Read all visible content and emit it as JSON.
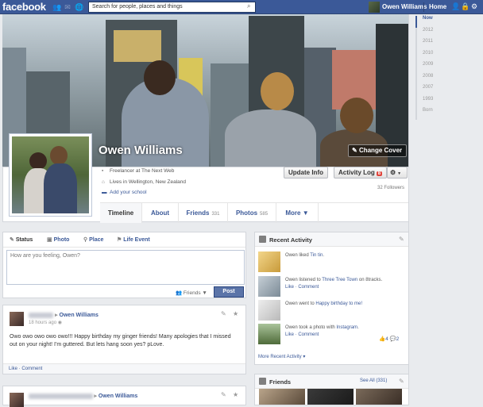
{
  "topbar": {
    "logo": "facebook",
    "search_placeholder": "Search for people, places and things",
    "user_name": "Owen Williams",
    "home_label": "Home"
  },
  "profile": {
    "name": "Owen Williams",
    "change_cover": "Change Cover",
    "info": {
      "work": "Freelancer at The Next Web",
      "location": "Lives in Wellington, New Zealand",
      "add_school": "Add your school"
    },
    "update_info": "Update Info",
    "activity_log": "Activity Log",
    "activity_badge": "8",
    "followers": "32 Followers"
  },
  "tabs": [
    {
      "label": "Timeline",
      "count": ""
    },
    {
      "label": "About",
      "count": ""
    },
    {
      "label": "Friends",
      "count": "331"
    },
    {
      "label": "Photos",
      "count": "585"
    },
    {
      "label": "More ▼",
      "count": ""
    }
  ],
  "timeline_nav": [
    "Now",
    "2012",
    "2011",
    "2010",
    "2009",
    "2008",
    "2007",
    "1993",
    "Born"
  ],
  "composer": {
    "tabs": [
      "Status",
      "Photo",
      "Place",
      "Life Event"
    ],
    "placeholder": "How are you feeling, Owen?",
    "audience": "Friends ▼",
    "post": "Post"
  },
  "posts": [
    {
      "author": "Owen Williams",
      "time": "18 hours ago",
      "text": "Owo owo owo owo owo!!! Happy birthday my ginger friends! Many apologies that I missed out on your night! I'm guttered. But lets hang soon yes? pLove.",
      "actions": "Like · Comment"
    },
    {
      "author": "Owen Williams"
    }
  ],
  "recent_activity": {
    "title": "Recent Activity",
    "items": [
      {
        "pre": "Owen liked ",
        "link": "Tin tin",
        "post": ".",
        "sub": ""
      },
      {
        "pre": "Owen listened to ",
        "link": "Three Tree Town",
        "post": " on 8tracks.",
        "sub": "Like · Comment"
      },
      {
        "pre": "Owen went to ",
        "link": "Happy birthday to me!",
        "post": "",
        "sub": ""
      },
      {
        "pre": "Owen took a photo with ",
        "link": "Instagram",
        "post": ".",
        "sub": "Like · Comment"
      }
    ],
    "likes": "4",
    "comments": "2",
    "more": "More Recent Activity ▾"
  },
  "friends_box": {
    "title": "Friends",
    "see_all": "See All (331)"
  },
  "colors": {
    "brand": "#3b5998",
    "accent_red": "#e0443b"
  }
}
